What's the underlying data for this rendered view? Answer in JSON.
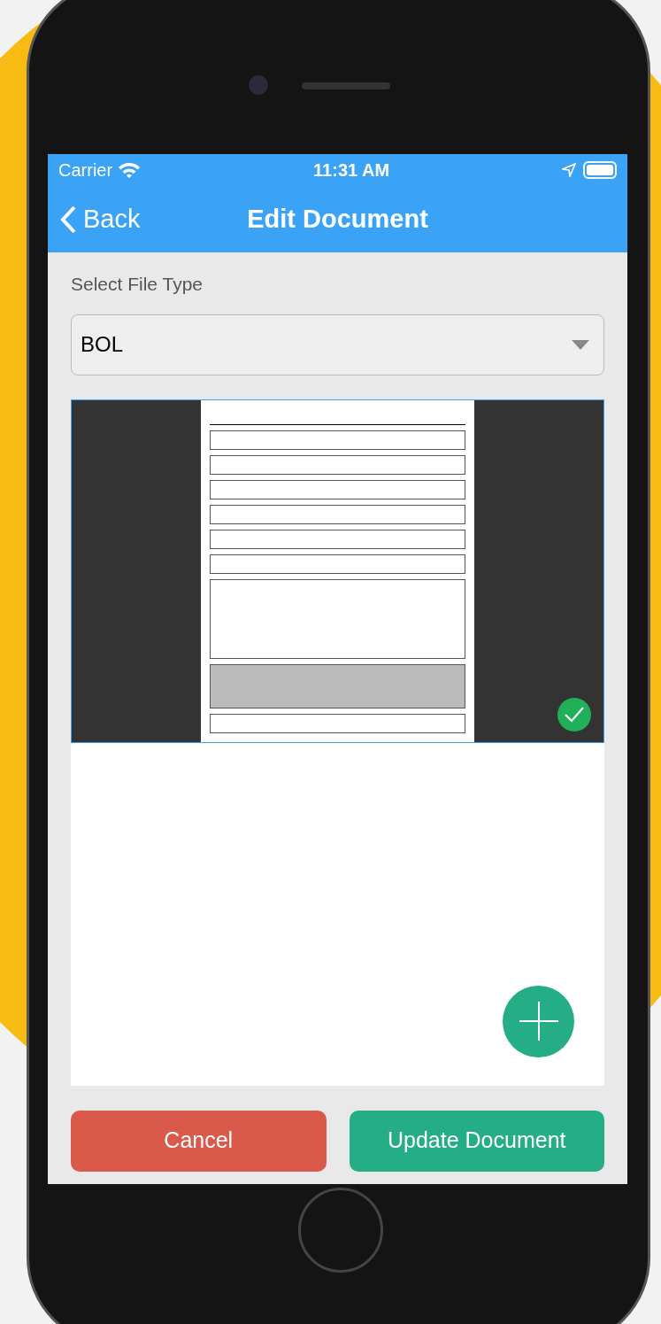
{
  "status_bar": {
    "carrier": "Carrier",
    "time": "11:31 AM"
  },
  "nav": {
    "back": "Back",
    "title": "Edit Document"
  },
  "file_type": {
    "label": "Select File Type",
    "value": "BOL"
  },
  "attachments": [
    {
      "selected": true
    }
  ],
  "buttons": [
    {
      "label": "Cancel",
      "kind": "cancel"
    },
    {
      "label": "Update Document",
      "kind": "primary"
    }
  ]
}
